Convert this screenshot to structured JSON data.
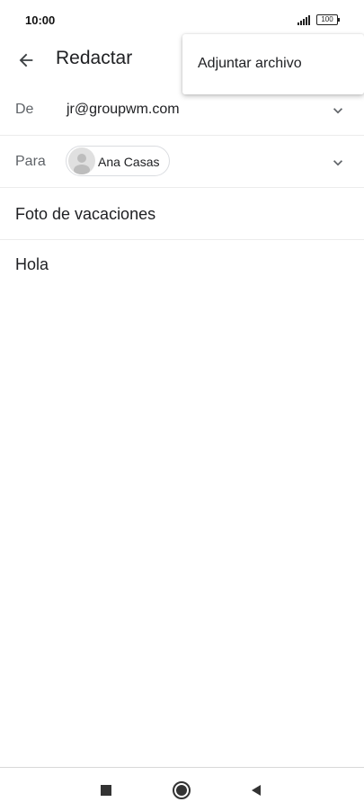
{
  "status_bar": {
    "time": "10:00",
    "battery": "100"
  },
  "app_bar": {
    "title": "Redactar",
    "back_icon": "arrow-back-icon"
  },
  "menu": {
    "items": [
      {
        "label": "Adjuntar archivo"
      }
    ]
  },
  "compose": {
    "from": {
      "label": "De",
      "value": "jr@groupwm.com"
    },
    "to": {
      "label": "Para",
      "recipients": [
        {
          "name": "Ana Casas"
        }
      ]
    },
    "subject": "Foto de vacaciones",
    "body": "Hola"
  },
  "nav_bar": {
    "icons": [
      "recents-square-icon",
      "home-circle-icon",
      "back-triangle-icon"
    ]
  },
  "colors": {
    "text": "#202124",
    "secondary": "#5f6368",
    "divider": "#ececec"
  }
}
